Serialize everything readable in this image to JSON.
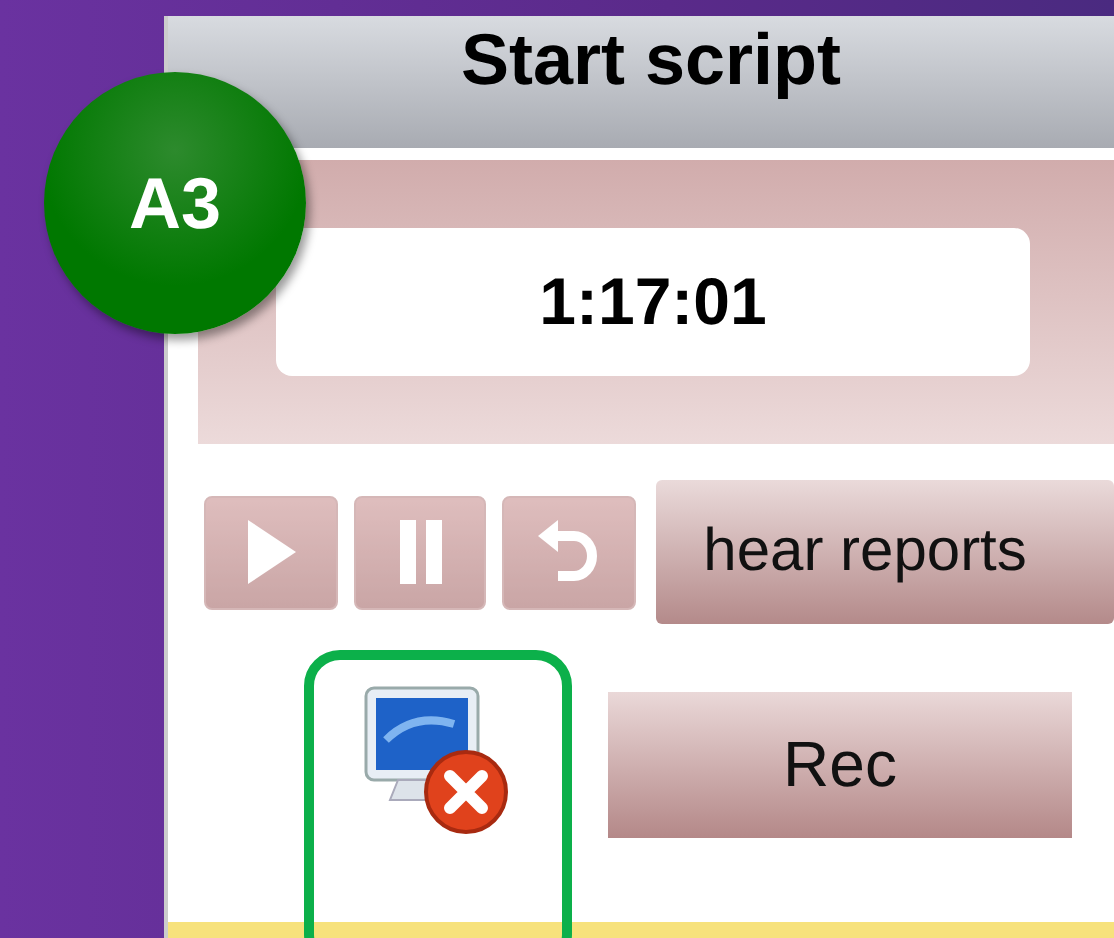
{
  "window": {
    "title": "Start script"
  },
  "timer": {
    "value": "1:17:01"
  },
  "media_buttons": [
    {
      "kind": "play",
      "disabled": true
    },
    {
      "kind": "pause",
      "disabled": true
    },
    {
      "kind": "rewind",
      "disabled": true
    }
  ],
  "hear_button": {
    "label": "hear reports"
  },
  "status_icon": {
    "kind": "disconnected"
  },
  "rec_button": {
    "label": "Rec"
  },
  "annotation": {
    "badge": "A3",
    "highlight": true
  }
}
